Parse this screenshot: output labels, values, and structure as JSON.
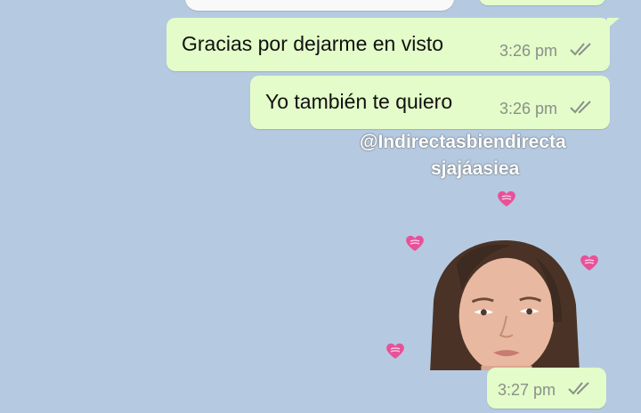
{
  "chat": {
    "messages": [
      {
        "text": "Gracias por dejarme en visto",
        "time": "3:26 pm"
      },
      {
        "text": "Yo también te quiero",
        "time": "3:26 pm"
      },
      {
        "text": "",
        "time": "3:27 pm"
      }
    ],
    "caption_line1": "@Indirectasbiendirecta",
    "caption_line2": "sjajáasiea",
    "read_icon": "double-check-icon",
    "sticker_icon": "pink-heart-icon"
  },
  "colors": {
    "background": "#b5cae1",
    "outgoing_bubble": "#e3fcc9",
    "ticks": "#8a8f8a",
    "heart": "#e8519a"
  }
}
